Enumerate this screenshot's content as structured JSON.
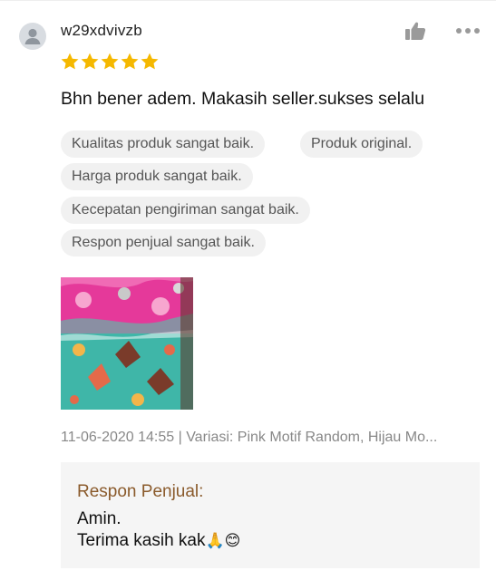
{
  "review": {
    "username": "w29xdvivzb",
    "rating": 5,
    "comment": "Bhn bener adem. Makasih seller.sukses selalu",
    "tags": [
      "Kualitas produk sangat baik.",
      "Produk original.",
      "Harga produk sangat baik.",
      "Kecepatan pengiriman sangat baik.",
      "Respon penjual sangat baik."
    ],
    "meta": "11-06-2020 14:55 | Variasi: Pink Motif Random, Hijau Mo...",
    "icons": {
      "avatar": "user-avatar-icon",
      "like": "thumbs-up-icon",
      "more": "more-options-icon",
      "star": "star-icon"
    },
    "colors": {
      "star": "#f5b800",
      "reply_title": "#8a5a2b",
      "tag_bg": "#f1f1f1",
      "reply_bg": "#f5f5f5"
    }
  },
  "seller_reply": {
    "title": "Respon Penjual:",
    "line1": "Amin.",
    "line2_text": "Terima kasih kak",
    "line2_emojis": "🙏😊"
  }
}
